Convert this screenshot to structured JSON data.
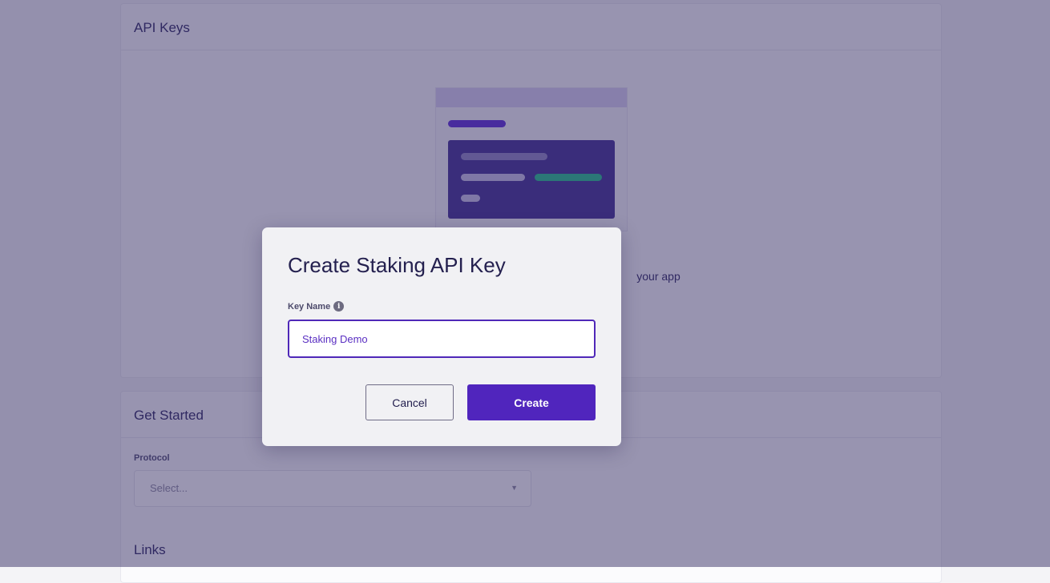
{
  "api_keys_card": {
    "title": "API Keys",
    "empty_text": "your app"
  },
  "get_started_card": {
    "title": "Get Started",
    "protocol_label": "Protocol",
    "protocol_placeholder": "Select...",
    "links_title": "Links"
  },
  "modal": {
    "title": "Create Staking API Key",
    "key_name_label": "Key Name",
    "key_name_value": "Staking Demo",
    "cancel_label": "Cancel",
    "create_label": "Create"
  },
  "icons": {
    "info": "info-icon",
    "select_chevron": "chevron-down-icon"
  },
  "colors": {
    "accent": "#5025bd",
    "overlay": "#362e64",
    "illustration_green": "#20c08a"
  }
}
